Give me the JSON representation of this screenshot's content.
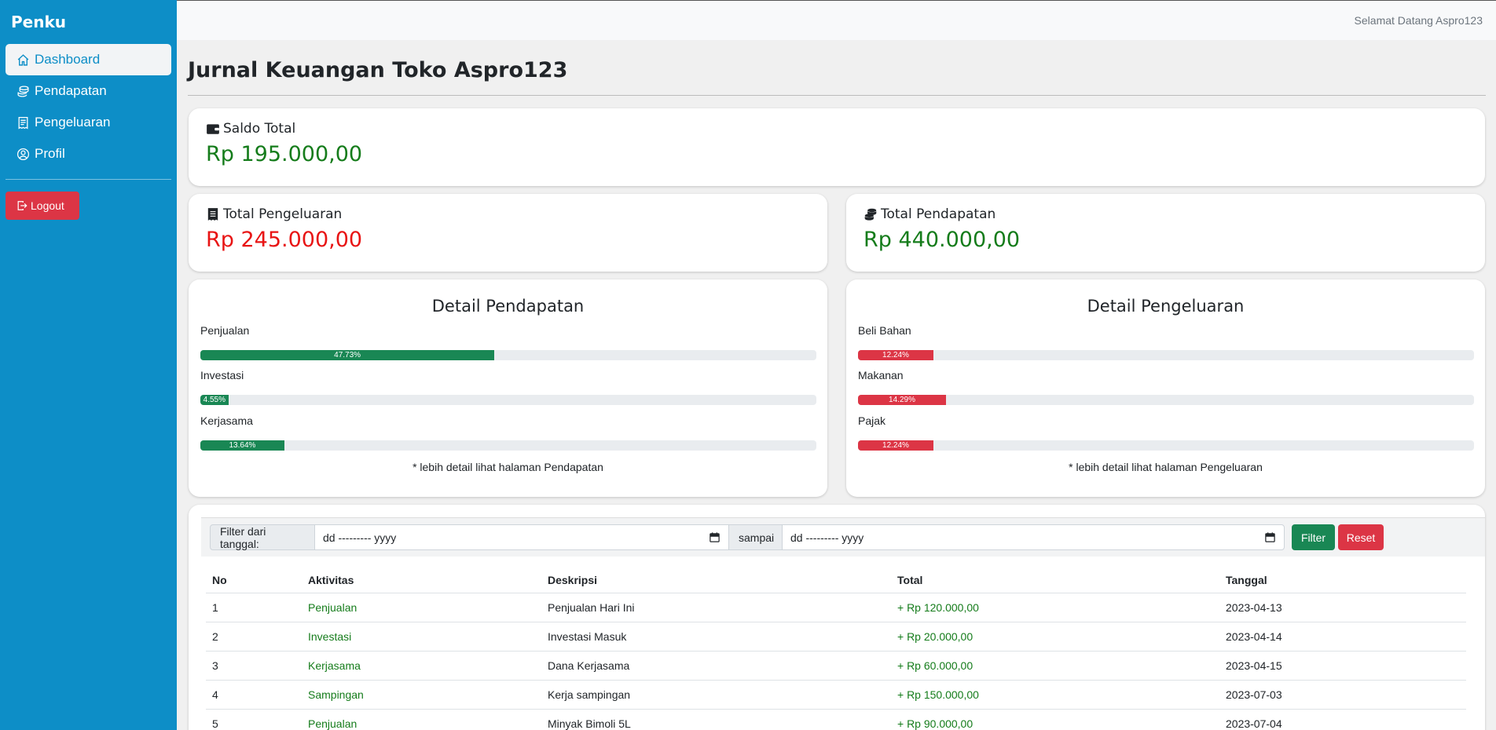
{
  "sidebar": {
    "brand": "Penku",
    "items": [
      {
        "label": "Dashboard",
        "icon": "home-icon",
        "active": true
      },
      {
        "label": "Pendapatan",
        "icon": "coins-icon",
        "active": false
      },
      {
        "label": "Pengeluaran",
        "icon": "receipt-icon",
        "active": false
      },
      {
        "label": "Profil",
        "icon": "user-circle-icon",
        "active": false
      }
    ],
    "logout_label": "Logout"
  },
  "topbar": {
    "welcome": "Selamat Datang Aspro123"
  },
  "page": {
    "title": "Jurnal Keuangan Toko Aspro123"
  },
  "saldo": {
    "label": "Saldo Total",
    "value": "Rp 195.000,00"
  },
  "pengeluaran_total": {
    "label": "Total Pengeluaran",
    "value": "Rp 245.000,00"
  },
  "pendapatan_total": {
    "label": "Total Pendapatan",
    "value": "Rp 440.000,00"
  },
  "detail_pendapatan": {
    "title": "Detail Pendapatan",
    "bars": [
      {
        "label": "Penjualan",
        "percent": 47.73,
        "text": "47.73%"
      },
      {
        "label": "Investasi",
        "percent": 4.55,
        "text": "4.55%"
      },
      {
        "label": "Kerjasama",
        "percent": 13.64,
        "text": "13.64%"
      }
    ],
    "note": "* lebih detail lihat halaman Pendapatan"
  },
  "detail_pengeluaran": {
    "title": "Detail Pengeluaran",
    "bars": [
      {
        "label": "Beli Bahan",
        "percent": 12.24,
        "text": "12.24%"
      },
      {
        "label": "Makanan",
        "percent": 14.29,
        "text": "14.29%"
      },
      {
        "label": "Pajak",
        "percent": 12.24,
        "text": "12.24%"
      }
    ],
    "note": "* lebih detail lihat halaman Pengeluaran"
  },
  "filter": {
    "from_label": "Filter dari tanggal:",
    "from_value": "dd --------- yyyy",
    "to_label": "sampai",
    "to_value": "dd --------- yyyy",
    "filter_button": "Filter",
    "reset_button": "Reset"
  },
  "table": {
    "headers": {
      "no": "No",
      "aktivitas": "Aktivitas",
      "deskripsi": "Deskripsi",
      "total": "Total",
      "tanggal": "Tanggal"
    },
    "rows": [
      {
        "no": "1",
        "aktivitas": "Penjualan",
        "deskripsi": "Penjualan Hari Ini",
        "total": "+ Rp 120.000,00",
        "tanggal": "2023-04-13"
      },
      {
        "no": "2",
        "aktivitas": "Investasi",
        "deskripsi": "Investasi Masuk",
        "total": "+ Rp 20.000,00",
        "tanggal": "2023-04-14"
      },
      {
        "no": "3",
        "aktivitas": "Kerjasama",
        "deskripsi": "Dana Kerjasama",
        "total": "+ Rp 60.000,00",
        "tanggal": "2023-04-15"
      },
      {
        "no": "4",
        "aktivitas": "Sampingan",
        "deskripsi": "Kerja sampingan",
        "total": "+ Rp 150.000,00",
        "tanggal": "2023-07-03"
      },
      {
        "no": "5",
        "aktivitas": "Penjualan",
        "deskripsi": "Minyak Bimoli 5L",
        "total": "+ Rp 90.000,00",
        "tanggal": "2023-07-04"
      }
    ]
  },
  "colors": {
    "sidebar": "#0d8ec7",
    "income": "#157c1b",
    "expense": "#e81414",
    "bar_income": "#198754",
    "bar_expense": "#dc3545"
  }
}
